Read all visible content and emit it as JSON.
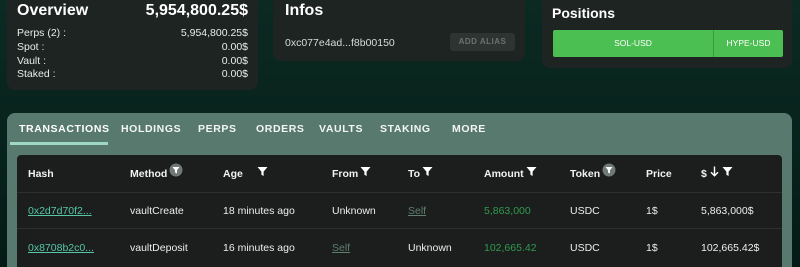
{
  "overview": {
    "title": "Overview",
    "total": "5,954,800.25$",
    "rows": [
      {
        "label": "Perps (2) :",
        "value": "5,954,800.25$"
      },
      {
        "label": "Spot :",
        "value": "0.00$"
      },
      {
        "label": "Vault :",
        "value": "0.00$"
      },
      {
        "label": "Staked :",
        "value": "0.00$"
      }
    ]
  },
  "infos": {
    "title": "Infos",
    "address": "0xc077e4ad...f8b00150",
    "alias_button": "ADD ALIAS"
  },
  "positions": {
    "title": "Positions",
    "items": [
      "SOL-USD",
      "HYPE-USD"
    ]
  },
  "tabs": [
    "TRANSACTIONS",
    "HOLDINGS",
    "PERPS",
    "ORDERS",
    "VAULTS",
    "STAKING",
    "MORE"
  ],
  "active_tab": "TRANSACTIONS",
  "table": {
    "headers": [
      "Hash",
      "Method",
      "Age",
      "From",
      "To",
      "Amount",
      "Token",
      "Price",
      "$"
    ],
    "rows": [
      {
        "hash": "0x2d7d70f2...",
        "method": "vaultCreate",
        "age": "18 minutes ago",
        "from": "Unknown",
        "to": "Self",
        "amount": "5,863,000",
        "token": "USDC",
        "price": "1$",
        "usd": "5,863,000$"
      },
      {
        "hash": "0x8708b2c0...",
        "method": "vaultDeposit",
        "age": "16 minutes ago",
        "from": "Self",
        "to": "Unknown",
        "amount": "102,665.42",
        "token": "USDC",
        "price": "1$",
        "usd": "102,665.42$"
      }
    ]
  },
  "colors": {
    "card": "#1e2422",
    "tabbar": "#587a6e",
    "green_button": "#4bbf52",
    "hash_link": "#55c7a7",
    "amount_green": "#2f9a4d"
  }
}
